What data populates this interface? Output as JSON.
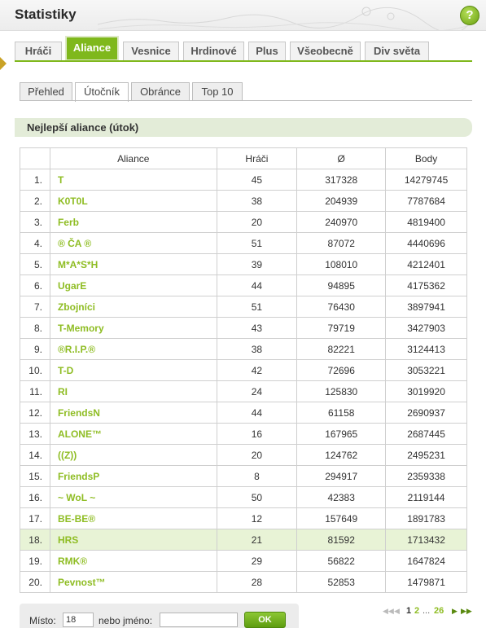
{
  "window": {
    "title": "Statistiky",
    "help_label": "?"
  },
  "main_tabs": [
    {
      "label": "Hráči",
      "active": false
    },
    {
      "label": "Aliance",
      "active": true
    },
    {
      "label": "Vesnice",
      "active": false
    },
    {
      "label": "Hrdinové",
      "active": false
    },
    {
      "label": "Plus",
      "active": false
    },
    {
      "label": "Všeobecně",
      "active": false
    },
    {
      "label": "Div světa",
      "active": false
    }
  ],
  "sub_tabs": [
    {
      "label": "Přehled",
      "active": false
    },
    {
      "label": "Útočník",
      "active": true
    },
    {
      "label": "Obránce",
      "active": false
    },
    {
      "label": "Top 10",
      "active": false
    }
  ],
  "section": {
    "title": "Nejlepší aliance (útok)"
  },
  "table": {
    "headers": [
      "",
      "Aliance",
      "Hráči",
      "Ø",
      "Body"
    ],
    "rows": [
      {
        "rank": "1.",
        "alliance": "T",
        "players": "45",
        "avg": "317328",
        "points": "14279745",
        "highlight": false
      },
      {
        "rank": "2.",
        "alliance": "K0T0L",
        "players": "38",
        "avg": "204939",
        "points": "7787684",
        "highlight": false
      },
      {
        "rank": "3.",
        "alliance": "Ferb",
        "players": "20",
        "avg": "240970",
        "points": "4819400",
        "highlight": false
      },
      {
        "rank": "4.",
        "alliance": "® ČA ®",
        "players": "51",
        "avg": "87072",
        "points": "4440696",
        "highlight": false
      },
      {
        "rank": "5.",
        "alliance": "M*A*S*H",
        "players": "39",
        "avg": "108010",
        "points": "4212401",
        "highlight": false
      },
      {
        "rank": "6.",
        "alliance": "UgarE",
        "players": "44",
        "avg": "94895",
        "points": "4175362",
        "highlight": false
      },
      {
        "rank": "7.",
        "alliance": "Zbojníci",
        "players": "51",
        "avg": "76430",
        "points": "3897941",
        "highlight": false
      },
      {
        "rank": "8.",
        "alliance": "T-Memory",
        "players": "43",
        "avg": "79719",
        "points": "3427903",
        "highlight": false
      },
      {
        "rank": "9.",
        "alliance": "®R.I.P.®",
        "players": "38",
        "avg": "82221",
        "points": "3124413",
        "highlight": false
      },
      {
        "rank": "10.",
        "alliance": "T-D",
        "players": "42",
        "avg": "72696",
        "points": "3053221",
        "highlight": false
      },
      {
        "rank": "11.",
        "alliance": "RI",
        "players": "24",
        "avg": "125830",
        "points": "3019920",
        "highlight": false
      },
      {
        "rank": "12.",
        "alliance": "FriendsN",
        "players": "44",
        "avg": "61158",
        "points": "2690937",
        "highlight": false
      },
      {
        "rank": "13.",
        "alliance": "ALONE™",
        "players": "16",
        "avg": "167965",
        "points": "2687445",
        "highlight": false
      },
      {
        "rank": "14.",
        "alliance": "((Z))",
        "players": "20",
        "avg": "124762",
        "points": "2495231",
        "highlight": false
      },
      {
        "rank": "15.",
        "alliance": "FriendsP",
        "players": "8",
        "avg": "294917",
        "points": "2359338",
        "highlight": false
      },
      {
        "rank": "16.",
        "alliance": "~ WoL ~",
        "players": "50",
        "avg": "42383",
        "points": "2119144",
        "highlight": false
      },
      {
        "rank": "17.",
        "alliance": "BE-BE®",
        "players": "12",
        "avg": "157649",
        "points": "1891783",
        "highlight": false
      },
      {
        "rank": "18.",
        "alliance": "HRS",
        "players": "21",
        "avg": "81592",
        "points": "1713432",
        "highlight": true
      },
      {
        "rank": "19.",
        "alliance": "RMK®",
        "players": "29",
        "avg": "56822",
        "points": "1647824",
        "highlight": false
      },
      {
        "rank": "20.",
        "alliance": "Pevnost™",
        "players": "28",
        "avg": "52853",
        "points": "1479871",
        "highlight": false
      }
    ]
  },
  "search": {
    "place_label": "Místo:",
    "place_value": "18",
    "name_label": "nebo jméno:",
    "name_value": "",
    "ok_label": "OK"
  },
  "pagination": {
    "first_icon": "first-page-icon",
    "prev_icon": "previous-page-icon",
    "next_icon": "next-page-icon",
    "last_icon": "last-page-icon",
    "current": "1",
    "next": "2",
    "ellipsis": "...",
    "last": "26"
  },
  "colors": {
    "accent": "#7fb81c",
    "link": "#8fbd24",
    "highlight_row": "#e8f3d6",
    "section_bar": "#e3ecd8"
  }
}
